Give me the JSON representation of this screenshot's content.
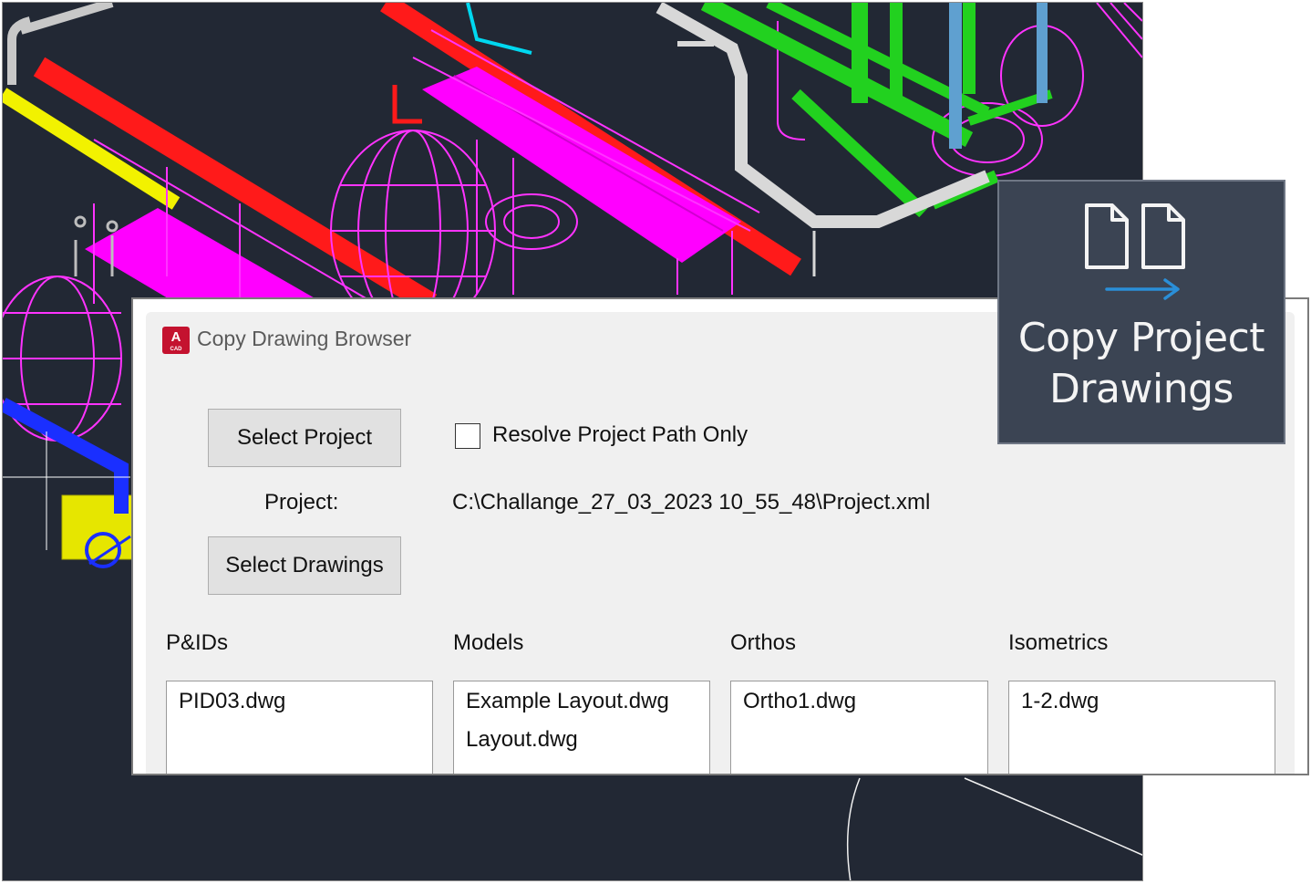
{
  "dialog": {
    "title": "Copy Drawing Browser",
    "app_icon_letter": "A",
    "app_icon_sub": "CAD",
    "select_project_label": "Select Project",
    "resolve_checkbox_label": "Resolve Project Path Only",
    "resolve_checked": false,
    "project_label": "Project:",
    "project_path": "C:\\Challange_27_03_2023 10_55_48\\Project.xml",
    "select_drawings_label": "Select Drawings",
    "columns": [
      {
        "header": "P&IDs",
        "items": [
          "PID03.dwg"
        ]
      },
      {
        "header": "Models",
        "items": [
          "Example Layout.dwg",
          "Layout.dwg"
        ]
      },
      {
        "header": "Orthos",
        "items": [
          "Ortho1.dwg"
        ]
      },
      {
        "header": "Isometrics",
        "items": [
          "1-2.dwg"
        ]
      }
    ]
  },
  "ribbon_button": {
    "label_line1": "Copy Project",
    "label_line2": "Drawings",
    "icon": "copy-documents-arrow-icon",
    "arrow_color": "#2a8fd8"
  },
  "colors": {
    "viewport_bg": "#222834",
    "pipe_red": "#ff1a1a",
    "pipe_green": "#22d11f",
    "platform_magenta": "#ff00ff",
    "pipe_yellow": "#f2f200",
    "pipe_blue": "#1a2fff",
    "pipe_cyan": "#00d8f0",
    "pipe_grey": "#c8c8c8"
  }
}
